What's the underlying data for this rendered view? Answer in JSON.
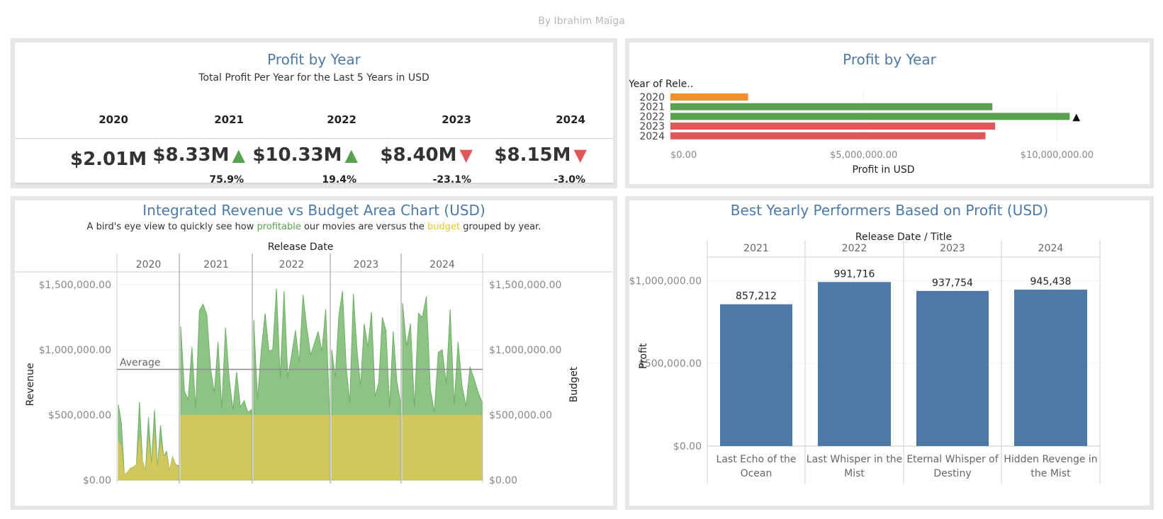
{
  "author": "By Ibrahim Maïga",
  "kpi_panel": {
    "title": "Profit by Year",
    "subtitle": "Total Profit Per Year for the Last 5 Years in USD",
    "columns": [
      {
        "year": "2020",
        "value": "$2.01M",
        "trend": "",
        "pct": ""
      },
      {
        "year": "2021",
        "value": "$8.33M",
        "trend": "up",
        "pct": "75.9%"
      },
      {
        "year": "2022",
        "value": "$10.33M",
        "trend": "up",
        "pct": "19.4%"
      },
      {
        "year": "2023",
        "value": "$8.40M",
        "trend": "down",
        "pct": "-23.1%"
      },
      {
        "year": "2024",
        "value": "$8.15M",
        "trend": "down",
        "pct": "-3.0%"
      }
    ],
    "up_glyph": "▲",
    "down_glyph": "▼",
    "up_color": "#59a14f",
    "down_color": "#e15759"
  },
  "chart_data": [
    {
      "type": "bar",
      "orientation": "horizontal",
      "title": "Profit by Year",
      "ylabel": "Year of Rele..",
      "xlabel": "Profit in USD",
      "categories": [
        "2020",
        "2021",
        "2022",
        "2023",
        "2024"
      ],
      "values": [
        2010000,
        8330000,
        10330000,
        8400000,
        8150000
      ],
      "colors": [
        "#f28e2b",
        "#59a14f",
        "#59a14f",
        "#e15759",
        "#e15759"
      ],
      "max_marker": "▲",
      "xlim": [
        0,
        10800000
      ],
      "xticks": [
        0,
        5000000,
        10000000
      ],
      "xtick_labels": [
        "$0.00",
        "$5,000,000.00",
        "$10,000,000.00"
      ]
    },
    {
      "type": "area",
      "title": "Integrated Revenue vs Budget Area Chart (USD)",
      "subtitle_parts": [
        "A bird's eye view to quickly see how ",
        "profitable",
        " our movies are versus the ",
        "budget",
        " grouped by year."
      ],
      "subtitle_colors": {
        "profitable": "#59a14f",
        "budget": "#e8c530"
      },
      "column_header": "Release Date",
      "year_panels": [
        "2020",
        "2021",
        "2022",
        "2023",
        "2024"
      ],
      "ylabel_left": "Revenue",
      "ylabel_right": "Budget",
      "ylim": [
        0,
        1500000
      ],
      "ytick_labels": [
        "$0.00",
        "$500,000.00",
        "$1,000,000.00",
        "$1,500,000.00"
      ],
      "reference_line": {
        "label": "Average",
        "value": 850000
      },
      "revenue_color": "#8cc483",
      "budget_color": "#d4c95a",
      "series": [
        {
          "name": "Revenue",
          "panels": [
            [
              580000,
              440000,
              40000,
              60000,
              90000,
              100000,
              120000,
              600000,
              150000,
              70000,
              480000,
              120000,
              540000,
              90000,
              420000,
              180000,
              220000,
              70000,
              180000,
              120000,
              110000
            ],
            [
              1180000,
              680000,
              620000,
              1020000,
              550000,
              1300000,
              1350000,
              1270000,
              860000,
              670000,
              1060000,
              550000,
              1170000,
              780000,
              540000,
              830000,
              560000,
              610000,
              520000,
              540000
            ],
            [
              1230000,
              620000,
              1000000,
              1280000,
              990000,
              1000000,
              1470000,
              780000,
              1450000,
              790000,
              960000,
              1150000,
              900000,
              1420000,
              1170000,
              960000,
              1050000,
              1140000,
              990000,
              1310000,
              530000
            ],
            [
              1000000,
              790000,
              1270000,
              1450000,
              880000,
              590000,
              1430000,
              1000000,
              720000,
              1200000,
              1020000,
              1290000,
              640000,
              750000,
              1250000,
              1150000,
              560000,
              1140000,
              760000,
              600000
            ],
            [
              1360000,
              1030000,
              1200000,
              560000,
              1280000,
              1250000,
              1410000,
              700000,
              520000,
              980000,
              1000000,
              740000,
              1310000,
              580000,
              1060000,
              720000,
              570000,
              870000,
              780000,
              680000,
              600000
            ]
          ]
        },
        {
          "name": "Budget",
          "panels": [
            [
              300000,
              260000,
              40000,
              60000,
              90000,
              100000,
              120000,
              350000,
              150000,
              70000,
              320000,
              120000,
              380000,
              90000,
              300000,
              180000,
              200000,
              70000,
              180000,
              120000,
              100000
            ],
            [
              500000,
              500000,
              500000,
              500000,
              500000,
              500000,
              500000,
              500000,
              500000,
              500000,
              500000,
              500000,
              500000,
              500000,
              500000,
              500000,
              500000,
              500000,
              500000,
              500000
            ],
            [
              500000,
              500000,
              500000,
              500000,
              500000,
              500000,
              500000,
              500000,
              500000,
              500000,
              500000,
              500000,
              500000,
              500000,
              500000,
              500000,
              500000,
              500000,
              500000,
              500000,
              500000
            ],
            [
              500000,
              500000,
              500000,
              500000,
              500000,
              500000,
              500000,
              500000,
              500000,
              500000,
              500000,
              500000,
              500000,
              500000,
              500000,
              500000,
              500000,
              500000,
              500000,
              500000
            ],
            [
              500000,
              500000,
              500000,
              500000,
              500000,
              500000,
              500000,
              500000,
              500000,
              500000,
              500000,
              500000,
              500000,
              500000,
              500000,
              500000,
              500000,
              500000,
              500000,
              500000,
              500000
            ]
          ]
        }
      ]
    },
    {
      "type": "bar",
      "title": "Best Yearly Performers Based on Profit (USD)",
      "column_header": "Release Date / Title",
      "ylabel": "Profit",
      "years": [
        "2021",
        "2022",
        "2023",
        "2024"
      ],
      "categories": [
        [
          "Last Echo of the",
          "Ocean"
        ],
        [
          "Last Whisper in the",
          "Mist"
        ],
        [
          "Eternal Whisper of",
          "Destiny"
        ],
        [
          "Hidden Revenge in",
          "the Mist"
        ]
      ],
      "values": [
        857212,
        991716,
        937754,
        945438
      ],
      "value_labels": [
        "857,212",
        "991,716",
        "937,754",
        "945,438"
      ],
      "ylim": [
        0,
        1100000
      ],
      "yticks": [
        0,
        500000,
        1000000
      ],
      "ytick_labels": [
        "$0.00",
        "$500,000.00",
        "$1,000,000.00"
      ],
      "color": "#4e79a7"
    }
  ]
}
